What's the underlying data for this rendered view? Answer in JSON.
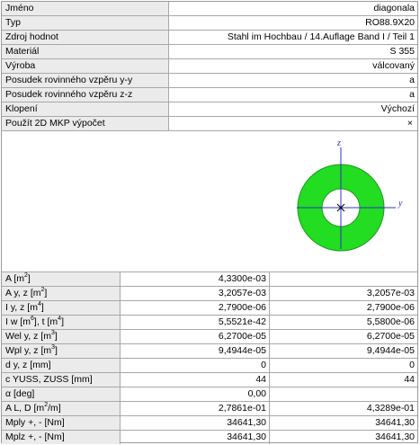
{
  "properties": [
    {
      "label": "Jméno",
      "value": "diagonala"
    },
    {
      "label": "Typ",
      "value": "RO88.9X20"
    },
    {
      "label": "Zdroj hodnot",
      "value": "Stahl im Hochbau / 14.Auflage Band I / Teil 1"
    },
    {
      "label": "Materiál",
      "value": "S 355"
    },
    {
      "label": "Výroba",
      "value": "válcovaný"
    },
    {
      "label": "Posudek rovinného vzpěru y-y",
      "value": "a"
    },
    {
      "label": "Posudek rovinného vzpěru z-z",
      "value": "a"
    },
    {
      "label": "Klopení",
      "value": "Výchozí"
    },
    {
      "label": "Použít 2D MKP výpočet",
      "value": "×"
    }
  ],
  "preview": {
    "axis_y_label": "y",
    "axis_z_label": "z",
    "section_fill": "#22dd22",
    "axis_color": "#3030c8"
  },
  "section_values": [
    {
      "label_parts": [
        "A [m",
        "2",
        "]"
      ],
      "v1": "4,3300e-03",
      "v2": ""
    },
    {
      "label_parts": [
        "A y, z [m",
        "2",
        "]"
      ],
      "v1": "3,2057e-03",
      "v2": "3,2057e-03"
    },
    {
      "label_parts": [
        "I y, z [m",
        "4",
        "]"
      ],
      "v1": "2,7900e-06",
      "v2": "2,7900e-06"
    },
    {
      "label_parts": [
        "I w [m",
        "6",
        "], t [m",
        "4",
        "]"
      ],
      "v1": "5,5521e-42",
      "v2": "5,5800e-06"
    },
    {
      "label_parts": [
        "Wel y, z [m",
        "3",
        "]"
      ],
      "v1": "6,2700e-05",
      "v2": "6,2700e-05"
    },
    {
      "label_parts": [
        "Wpl y, z [m",
        "3",
        "]"
      ],
      "v1": "9,4944e-05",
      "v2": "9,4944e-05"
    },
    {
      "label_parts": [
        "d y, z [mm]"
      ],
      "v1": "0",
      "v2": "0"
    },
    {
      "label_parts": [
        "c YUSS, ZUSS [mm]"
      ],
      "v1": "44",
      "v2": "44"
    },
    {
      "label_parts": [
        "α [deg]"
      ],
      "v1": "0,00",
      "v2": ""
    },
    {
      "label_parts": [
        "A L, D [m",
        "2",
        "/m]"
      ],
      "v1": "2,7861e-01",
      "v2": "4,3289e-01"
    },
    {
      "label_parts": [
        "Mply +, - [Nm]"
      ],
      "v1": "34641,30",
      "v2": "34641,30"
    },
    {
      "label_parts": [
        "Mplz +, - [Nm]"
      ],
      "v1": "34641,30",
      "v2": "34641,30"
    }
  ]
}
